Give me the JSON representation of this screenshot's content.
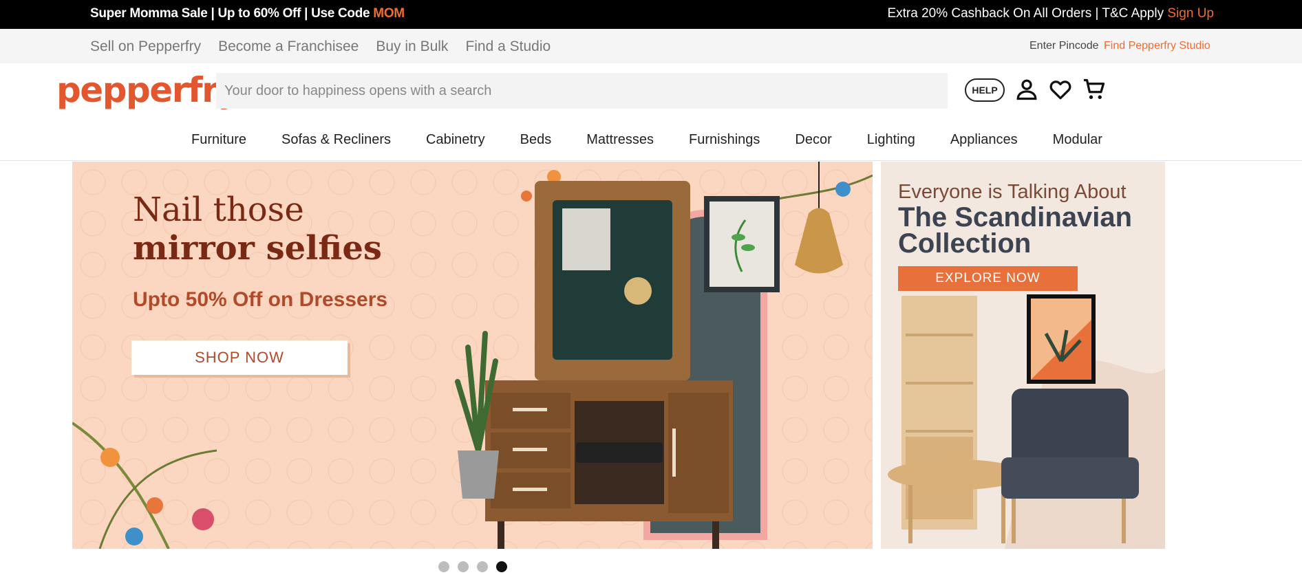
{
  "promo": {
    "left_text": "Super Momma Sale | Up to 60% Off | Use Code ",
    "code": "MOM",
    "right_text": "Extra 20% Cashback On All Orders | T&C Apply ",
    "signup": "Sign Up"
  },
  "utility": {
    "links": [
      "Sell on Pepperfry",
      "Become a Franchisee",
      "Buy in Bulk",
      "Find a Studio"
    ],
    "pincode": "Enter Pincode",
    "studio": "Find Pepperfry Studio"
  },
  "header": {
    "logo": "pepperfry",
    "search_placeholder": "Your door to happiness opens with a search",
    "help": "HELP"
  },
  "icons": {
    "account": "user-icon",
    "wishlist": "heart-icon",
    "cart": "cart-icon"
  },
  "nav": [
    "Furniture",
    "Sofas & Recliners",
    "Cabinetry",
    "Beds",
    "Mattresses",
    "Furnishings",
    "Decor",
    "Lighting",
    "Appliances",
    "Modular"
  ],
  "hero": {
    "line1": "Nail those",
    "line2": "mirror selfies",
    "offer": "Upto 50% Off on Dressers",
    "cta": "SHOP NOW"
  },
  "side_banner": {
    "eyebrow": "Everyone is Talking About",
    "title": "The Scandinavian Collection",
    "cta": "EXPLORE NOW"
  },
  "carousel": {
    "count": 4,
    "active_index": 3
  },
  "colors": {
    "accent": "#f26b2f",
    "hero_bg": "#fbd7c1",
    "hero_text": "#7a2a14"
  }
}
